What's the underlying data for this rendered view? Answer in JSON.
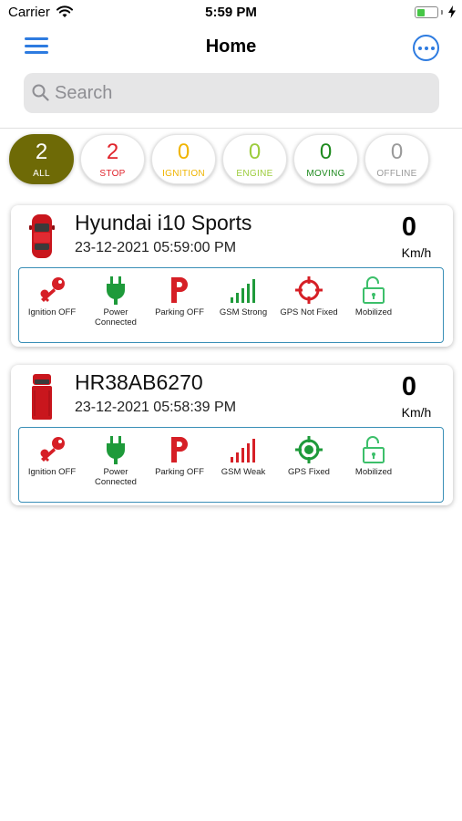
{
  "status_bar": {
    "carrier": "Carrier",
    "time": "5:59 PM"
  },
  "nav": {
    "title": "Home"
  },
  "search": {
    "placeholder": "Search"
  },
  "filters": [
    {
      "count": "2",
      "label": "ALL",
      "color": "#ffffff"
    },
    {
      "count": "2",
      "label": "STOP",
      "color": "#e0242c"
    },
    {
      "count": "0",
      "label": "IGNITION",
      "color": "#f0b400"
    },
    {
      "count": "0",
      "label": "ENGINE",
      "color": "#9ccc3c"
    },
    {
      "count": "0",
      "label": "MOVING",
      "color": "#1e8a1e"
    },
    {
      "count": "0",
      "label": "OFFLINE",
      "color": "#9a9a9a"
    }
  ],
  "vehicles": [
    {
      "name": "Hyundai i10 Sports",
      "timestamp": "23-12-2021 05:59:00 PM",
      "speed": "0",
      "speed_unit": "Km/h",
      "icon": "red-car-icon",
      "statuses": {
        "ignition": "Ignition OFF",
        "power": "Power Connected",
        "parking": "Parking OFF",
        "gsm": "GSM Strong",
        "gps": "GPS Not Fixed",
        "mobilized": "Mobilized"
      }
    },
    {
      "name": "HR38AB6270",
      "timestamp": "23-12-2021 05:58:39 PM",
      "speed": "0",
      "speed_unit": "Km/h",
      "icon": "red-truck-icon",
      "statuses": {
        "ignition": "Ignition OFF",
        "power": "Power Connected",
        "parking": "Parking OFF",
        "gsm": "GSM Weak",
        "gps": "GPS Fixed",
        "mobilized": "Mobilized"
      }
    }
  ],
  "colors": {
    "accent": "#2d7be0",
    "active_chip": "#6e6a06",
    "status_border": "#3a8fb7",
    "red": "#d61f26",
    "green": "#1e9a3a"
  }
}
